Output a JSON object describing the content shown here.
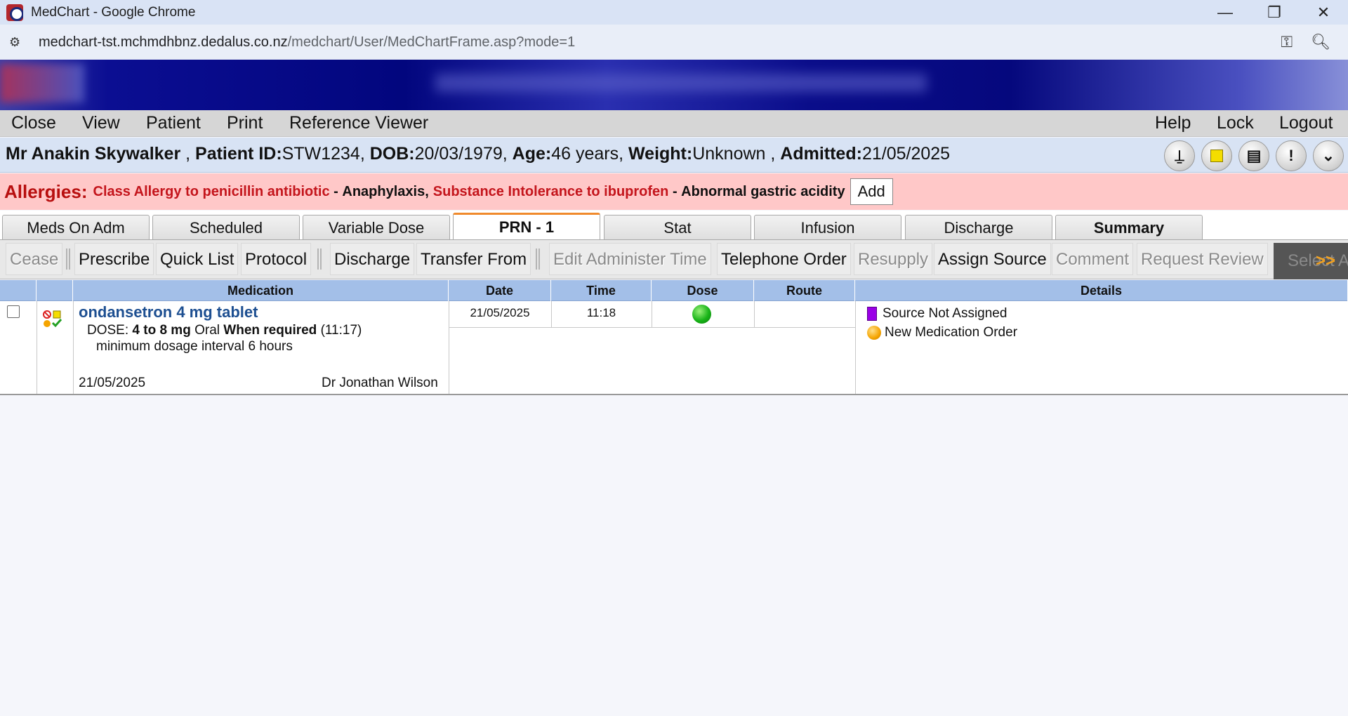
{
  "window": {
    "title": "MedChart - Google Chrome",
    "minimize": "—",
    "restore": "❐",
    "close": "✕"
  },
  "address": {
    "host": "medchart-tst.mchmdhbnz.dedalus.co.nz",
    "path": "/medchart/User/MedChartFrame.asp?mode=1"
  },
  "menu": {
    "close": "Close",
    "view": "View",
    "patient": "Patient",
    "print": "Print",
    "reference_viewer": "Reference Viewer",
    "help": "Help",
    "lock": "Lock",
    "logout": "Logout"
  },
  "patient": {
    "name": "Mr Anakin Skywalker",
    "id_label": "Patient ID:",
    "id": "STW1234",
    "dob_label": "DOB:",
    "dob": "20/03/1979",
    "age_label": "Age:",
    "age": "46 years",
    "weight_label": "Weight:",
    "weight": "Unknown",
    "admitted_label": "Admitted:",
    "admitted": "21/05/2025",
    "icons": [
      "lock-bell-icon",
      "yellow-square-icon",
      "notes-icon",
      "alert-icon",
      "expand-down-icon"
    ]
  },
  "allergies": {
    "label": "Allergies:",
    "items": [
      {
        "allergen": "Class Allergy to penicillin antibiotic",
        "reaction": "Anaphylaxis"
      },
      {
        "allergen": "Substance Intolerance to ibuprofen",
        "reaction": "Abnormal gastric acidity"
      }
    ],
    "add_label": "Add"
  },
  "tabs": [
    "Meds On Adm",
    "Scheduled",
    "Variable Dose",
    "PRN - 1",
    "Stat",
    "Infusion",
    "Discharge",
    "Summary"
  ],
  "active_tab": "PRN - 1",
  "toolbar": {
    "cease": "Cease",
    "prescribe": "Prescribe",
    "quick_list": "Quick List",
    "protocol": "Protocol",
    "discharge": "Discharge",
    "transfer_from": "Transfer From",
    "edit_administer_time": "Edit Administer Time",
    "telephone_order": "Telephone Order",
    "resupply": "Resupply",
    "assign_source": "Assign Source",
    "comment": "Comment",
    "request_review": "Request Review",
    "select_all": "Select All",
    "more": ">>"
  },
  "grid": {
    "headers": {
      "medication": "Medication",
      "date": "Date",
      "time": "Time",
      "dose": "Dose",
      "route": "Route",
      "details": "Details"
    },
    "rows": [
      {
        "name": "ondansetron 4 mg tablet",
        "dose_prefix": "DOSE: ",
        "dose": "4 to 8 mg",
        "route": "Oral",
        "frequency": "When required",
        "time_note": "(11:17)",
        "instruction": "minimum dosage interval 6 hours",
        "start_date": "21/05/2025",
        "prescriber": "Dr Jonathan Wilson",
        "admin_date": "21/05/2025",
        "admin_time": "11:18",
        "admin_route": "",
        "details": [
          "Source Not Assigned",
          "New Medication Order"
        ]
      }
    ]
  },
  "colors": {
    "brand": "#02067e",
    "allergy_bg": "#ffc8c8",
    "grid_header": "#a3bfe8",
    "dose_given": "#18b418",
    "source_not_assigned": "#9a00e6",
    "new_order": "#f5a400"
  }
}
